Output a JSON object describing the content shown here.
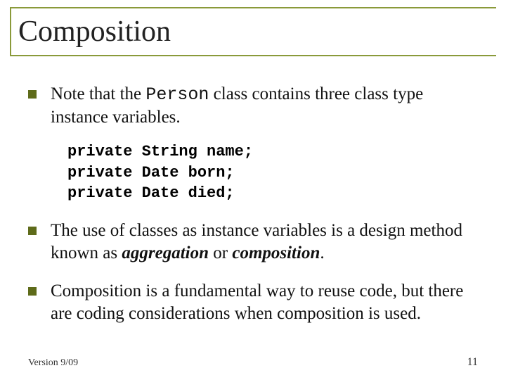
{
  "title": "Composition",
  "bullets": [
    {
      "pre": "Note that the ",
      "code": "Person",
      "post": " class contains three class type instance variables."
    },
    {
      "pre": "The use of classes as instance variables is a design method known as ",
      "em1": "aggregation",
      "mid": " or ",
      "em2": "composition",
      "post": "."
    },
    {
      "text": "Composition  is a fundamental way to reuse code, but there are coding considerations when composition is used."
    }
  ],
  "code_lines": [
    "private String name;",
    "private Date born;",
    "private Date died;"
  ],
  "footer": {
    "left": "Version 9/09",
    "right": "11"
  }
}
